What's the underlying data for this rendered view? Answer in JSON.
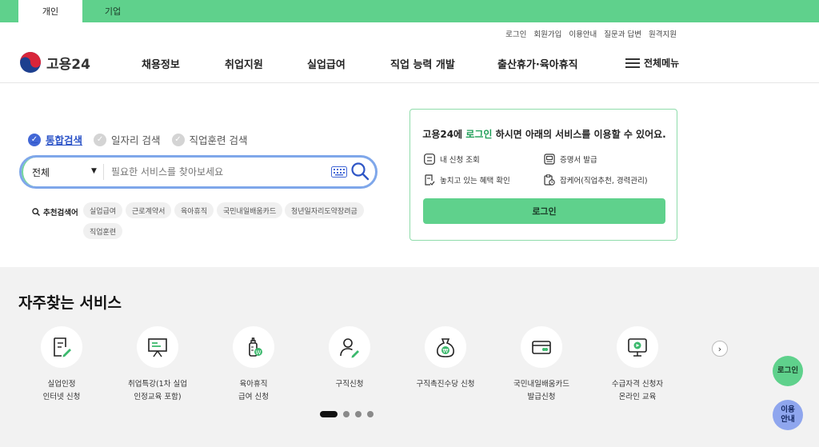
{
  "top_tabs": [
    "개인",
    "기업"
  ],
  "util_links": [
    "로그인",
    "회원가입",
    "이용안내",
    "질문과 답변",
    "원격지원"
  ],
  "logo": {
    "text": "고용24"
  },
  "gnb": [
    "채용정보",
    "취업지원",
    "실업급여",
    "직업 능력 개발",
    "출산휴가·육아휴직"
  ],
  "all_menu": "전체메뉴",
  "search": {
    "types": [
      "통합검색",
      "일자리 검색",
      "직업훈련 검색"
    ],
    "category": "전체",
    "placeholder": "필요한 서비스를 찾아보세요",
    "recommend_label": "추천검색어",
    "keywords": [
      "실업급여",
      "근로계약서",
      "육아휴직",
      "국민내일배움카드",
      "청년일자리도약장려금",
      "직업훈련"
    ]
  },
  "login_box": {
    "title_pre": "고용24에 ",
    "title_highlight": "로그인",
    "title_post": " 하시면 아래의 서비스를 이용할 수 있어요.",
    "items": [
      "내 신청 조회",
      "증명서 발급",
      "놓치고 있는 혜택 확인",
      "잡케어(직업추천, 경력관리)"
    ],
    "button": "로그인"
  },
  "services": {
    "title": "자주찾는 서비스",
    "items": [
      {
        "label": "실업인정\n인터넷 신청",
        "icon": "document-pen-icon"
      },
      {
        "label": "취업특강(1차 실업\n인정교육 포함)",
        "icon": "presentation-board-icon"
      },
      {
        "label": "육아휴직\n급여 신청",
        "icon": "baby-bottle-icon"
      },
      {
        "label": "구직신청",
        "icon": "person-pen-icon"
      },
      {
        "label": "구직촉진수당 신청",
        "icon": "money-bag-icon"
      },
      {
        "label": "국민내일배움카드\n발급신청",
        "icon": "card-icon"
      },
      {
        "label": "수급자격 신청자\n온라인 교육",
        "icon": "monitor-play-icon"
      }
    ]
  },
  "float_buttons": [
    "로그인",
    "이용\n안내"
  ],
  "colors": {
    "brand_green": "#5fd18c",
    "accent_blue": "#4267d6"
  }
}
